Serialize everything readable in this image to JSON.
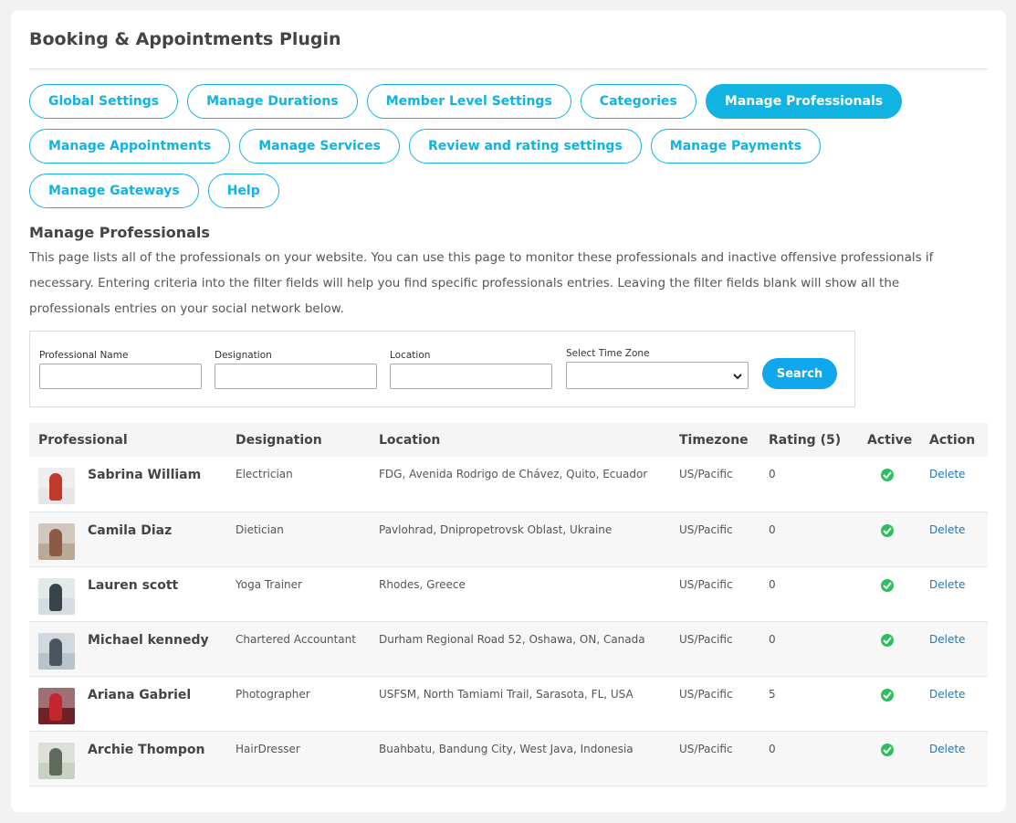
{
  "header": {
    "title": "Booking & Appointments Plugin"
  },
  "tabs": [
    {
      "label": "Global Settings",
      "active": false
    },
    {
      "label": "Manage Durations",
      "active": false
    },
    {
      "label": "Member Level Settings",
      "active": false
    },
    {
      "label": "Categories",
      "active": false
    },
    {
      "label": "Manage Professionals",
      "active": true
    },
    {
      "label": "Manage Appointments",
      "active": false
    },
    {
      "label": "Manage Services",
      "active": false
    },
    {
      "label": "Review and rating settings",
      "active": false
    },
    {
      "label": "Manage Payments",
      "active": false
    },
    {
      "label": "Manage Gateways",
      "active": false
    },
    {
      "label": "Help",
      "active": false
    }
  ],
  "section": {
    "title": "Manage Professionals",
    "description": "This page lists all of the professionals on your website. You can use this page to monitor these professionals and inactive offensive professionals if necessary. Entering criteria into the filter fields will help you find specific professionals entries. Leaving the filter fields blank will show all the professionals entries on your social network below."
  },
  "filters": {
    "name_label": "Professional Name",
    "name_value": "",
    "designation_label": "Designation",
    "designation_value": "",
    "location_label": "Location",
    "location_value": "",
    "timezone_label": "Select Time Zone",
    "timezone_value": "",
    "search_label": "Search"
  },
  "table": {
    "columns": [
      "Professional",
      "Designation",
      "Location",
      "Timezone",
      "Rating (5)",
      "Active",
      "Action"
    ],
    "rows": [
      {
        "name": "Sabrina William",
        "designation": "Electrician",
        "location": "FDG, Avenida Rodrigo de Chávez, Quito, Ecuador",
        "timezone": "US/Pacific",
        "rating": "0",
        "active": true,
        "action": "Delete",
        "avatar_colors": [
          "#e9e4e6",
          "#c0392b"
        ]
      },
      {
        "name": "Camila Diaz",
        "designation": "Dietician",
        "location": "Pavlohrad, Dnipropetrovsk Oblast, Ukraine",
        "timezone": "US/Pacific",
        "rating": "0",
        "active": true,
        "action": "Delete",
        "avatar_colors": [
          "#b9aa98",
          "#8a5a44"
        ]
      },
      {
        "name": "Lauren scott",
        "designation": "Yoga Trainer",
        "location": "Rhodes, Greece",
        "timezone": "US/Pacific",
        "rating": "0",
        "active": true,
        "action": "Delete",
        "avatar_colors": [
          "#d5dde0",
          "#39434a"
        ]
      },
      {
        "name": "Michael kennedy",
        "designation": "Chartered Accountant",
        "location": "Durham Regional Road 52, Oshawa, ON, Canada",
        "timezone": "US/Pacific",
        "rating": "0",
        "active": true,
        "action": "Delete",
        "avatar_colors": [
          "#b8c4cc",
          "#4b5560"
        ]
      },
      {
        "name": "Ariana Gabriel",
        "designation": "Photographer",
        "location": "USFSM, North Tamiami Trail, Sarasota, FL, USA",
        "timezone": "US/Pacific",
        "rating": "5",
        "active": true,
        "action": "Delete",
        "avatar_colors": [
          "#6e2228",
          "#c1272d"
        ]
      },
      {
        "name": "Archie Thompon",
        "designation": "HairDresser",
        "location": "Buahbatu, Bandung City, West Java, Indonesia",
        "timezone": "US/Pacific",
        "rating": "0",
        "active": true,
        "action": "Delete",
        "avatar_colors": [
          "#c9d0c4",
          "#5f6b5a"
        ]
      }
    ]
  },
  "colors": {
    "accent": "#11b3e3",
    "active_check": "#2dbe60",
    "link": "#1979c3"
  },
  "icons": {
    "select_caret": "chevron-down-icon",
    "active": "check-circle-icon"
  }
}
